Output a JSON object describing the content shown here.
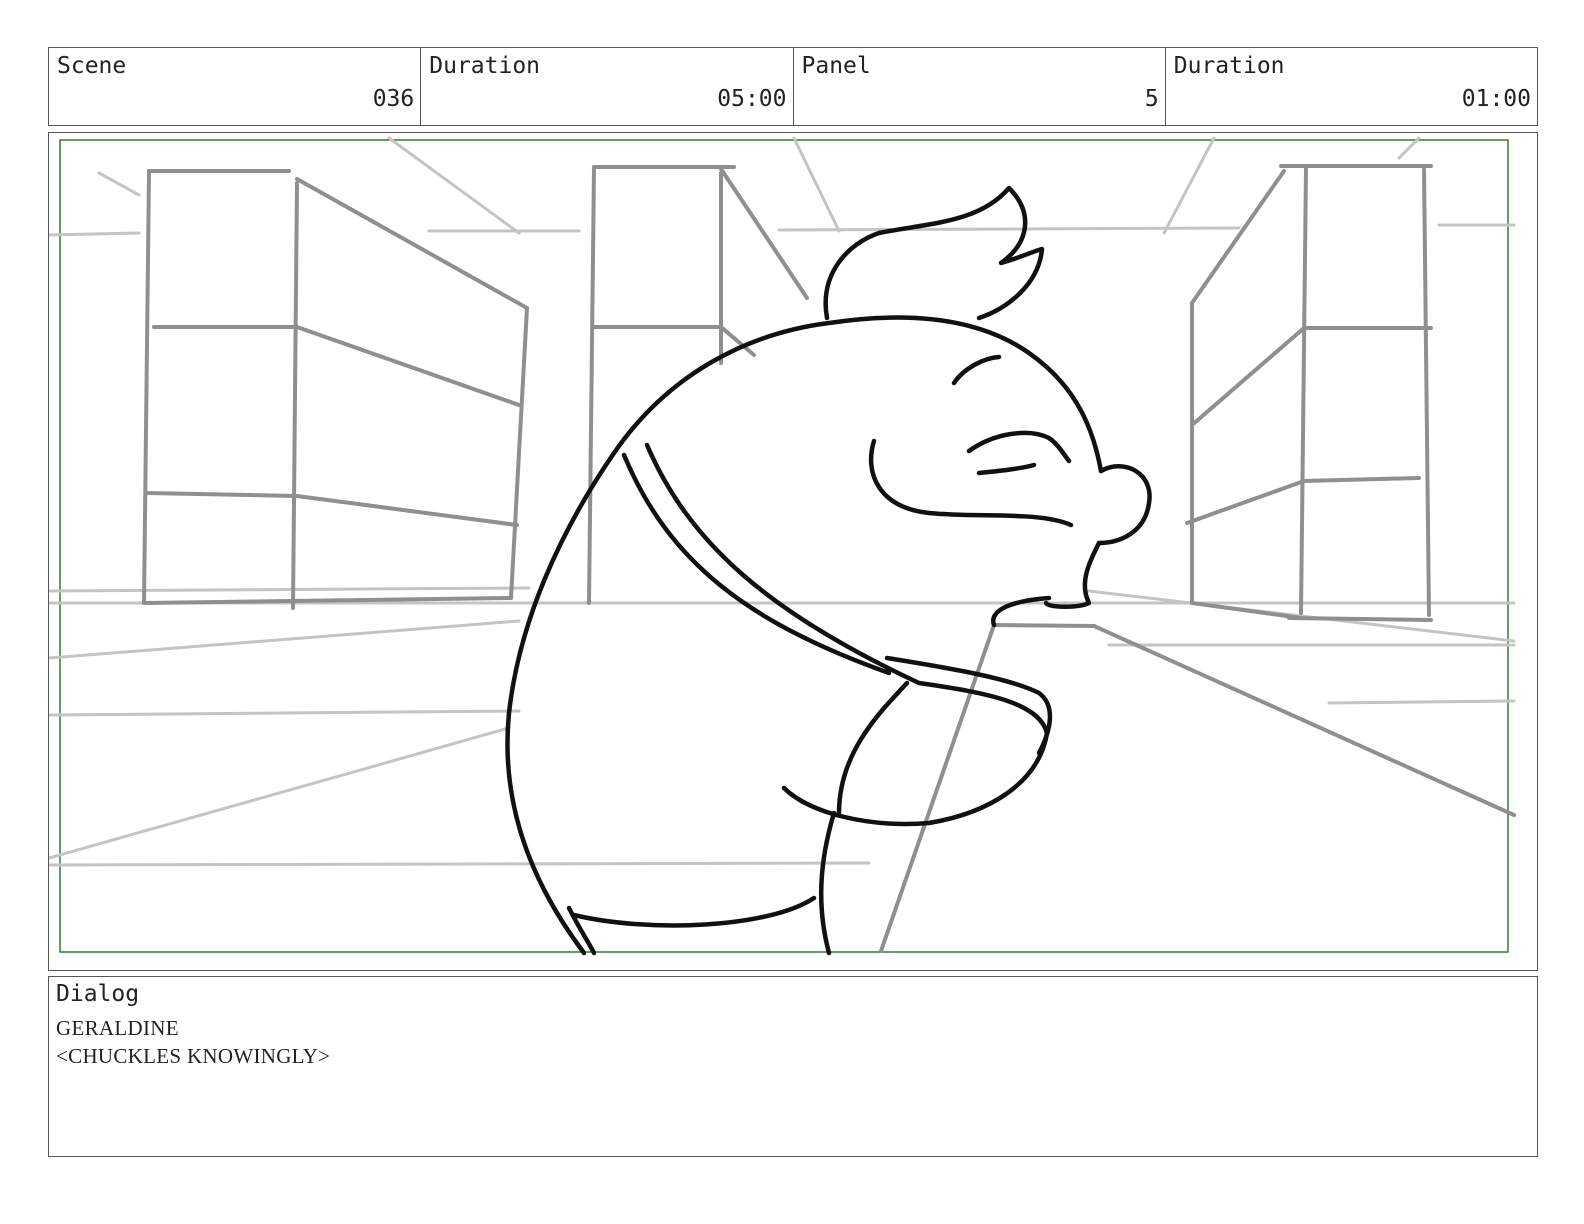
{
  "header": {
    "scene_label": "Scene",
    "scene_value": "036",
    "duration_label": "Duration",
    "duration_value": "05:00",
    "panel_label": "Panel",
    "panel_value": "5",
    "panel_duration_label": "Duration",
    "panel_duration_value": "01:00"
  },
  "colors": {
    "frame_border": "#2e7d32",
    "sketch_bg": "#9e9e9e",
    "character_line": "#111111"
  },
  "dialog": {
    "label": "Dialog",
    "character": "GERALDINE",
    "line": "<CHUCKLES KNOWINGLY>"
  }
}
